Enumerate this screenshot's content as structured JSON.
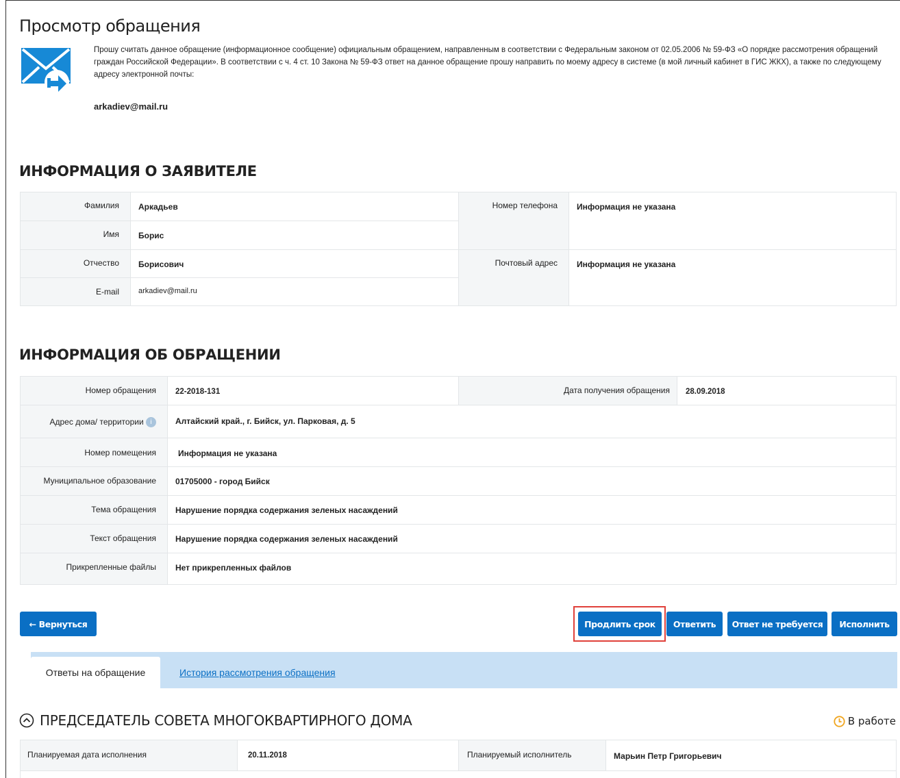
{
  "page": {
    "title": "Просмотр обращения",
    "intro_text": "Прошу считать данное обращение (информационное сообщение) официальным обращением, направленным в соответствии с Федеральным законом от 02.05.2006 № 59-ФЗ «О порядке рассмотрения обращений граждан Российской Федерации». В соответствии с ч. 4 ст. 10 Закона № 59-ФЗ ответ на данное обращение прошу направить по моему адресу в системе (в мой личный кабинет в ГИС ЖКХ), а также по следующему адресу электронной почты:",
    "intro_email": "arkadiev@mail.ru",
    "icon": "envelope-forward-icon"
  },
  "applicant": {
    "section_title": "ИНФОРМАЦИЯ О ЗАЯВИТЕЛЕ",
    "last_name_label": "Фамилия",
    "last_name": "Аркадьев",
    "first_name_label": "Имя",
    "first_name": "Борис",
    "patronymic_label": "Отчество",
    "patronymic": "Борисович",
    "email_label": "E-mail",
    "email": "arkadiev@mail.ru",
    "phone_label": "Номер телефона",
    "phone": "Информация не указана",
    "address_label": "Почтовый адрес",
    "address": "Информация не указана"
  },
  "request": {
    "section_title": "ИНФОРМАЦИЯ ОБ ОБРАЩЕНИИ",
    "number_label": "Номер обращения",
    "number": "22-2018-131",
    "received_label": "Дата получения обращения",
    "received": "28.09.2018",
    "house_address_label": "Адрес дома/ территории",
    "house_address": "Алтайский край., г. Бийск, ул. Парковая, д. 5",
    "room_label": "Номер помещения",
    "room": "Информация не указана",
    "municipality_label": "Муниципальное образование",
    "municipality": "01705000 - город Бийск",
    "topic_label": "Тема обращения",
    "topic": "Нарушение порядка содержания зеленых насаждений",
    "text_label": "Текст обращения",
    "text": "Нарушение порядка содержания зеленых насаждений",
    "files_label": "Прикрепленные файлы",
    "files": "Нет прикрепленных файлов"
  },
  "actions": {
    "back": "← Вернуться",
    "extend": "Продлить срок",
    "reply": "Ответить",
    "no_reply": "Ответ не требуется",
    "execute": "Исполнить"
  },
  "tabs": {
    "answers": "Ответы на обращение",
    "history": "История рассмотрения обращения"
  },
  "answer_block": {
    "title": "ПРЕДСЕДАТЕЛЬ СОВЕТА МНОГОКВАРТИРНОГО ДОМА",
    "status": "В работе",
    "planned_date_label": "Планируемая дата исполнения",
    "planned_date": "20.11.2018",
    "planned_executor_label": "Планируемый исполнитель",
    "planned_executor": "Марьин Петр Григорьевич"
  },
  "colors": {
    "accent": "#0a6fc4",
    "tabs_bg": "#c8e0f5",
    "label_bg": "#f4f6f7",
    "highlight": "#e0403a",
    "status_icon": "#f0a51e"
  }
}
